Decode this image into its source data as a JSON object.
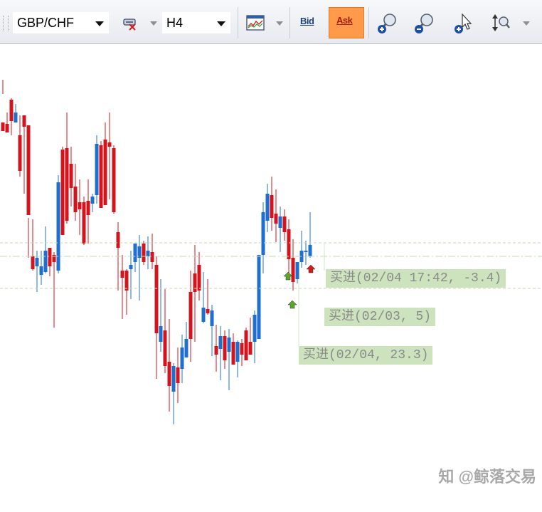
{
  "toolbar": {
    "symbol": "GBP/CHF",
    "timeframe": "H4",
    "bid_label": "Bid",
    "ask_label": "Ask",
    "icons": [
      "remove-indicator-icon",
      "chart-type-icon",
      "zoom-in-icon",
      "zoom-out-icon",
      "cursor-add-icon",
      "vertical-zoom-icon"
    ]
  },
  "chart_data": {
    "type": "candlestick",
    "colors": {
      "up": "#1f6fd1",
      "down": "#d2141c"
    },
    "trade_tags": [
      {
        "text": "买进(02/04 17:42, -3.4)"
      },
      {
        "text": "买进(02/03, 5)"
      },
      {
        "text": "买进(02/04, 23.3)"
      }
    ]
  },
  "watermark": "知 @鲸落交易"
}
